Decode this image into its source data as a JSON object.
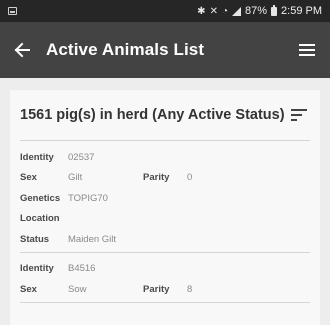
{
  "status_bar": {
    "icons": [
      "image-notification-icon",
      "bluetooth-icon",
      "mute-icon",
      "wifi-icon",
      "cell-signal-icon",
      "battery-icon"
    ],
    "battery": "87%",
    "time": "2:59 PM"
  },
  "app_bar": {
    "title": "Active Animals List",
    "back_icon": "arrow-left-icon",
    "menu_icon": "hamburger-menu-icon",
    "background": "#434343"
  },
  "summary": {
    "text": "1561 pig(s) in herd (Any Active Status)",
    "sort_icon": "sort-icon"
  },
  "labels": {
    "identity": "Identity",
    "sex": "Sex",
    "parity": "Parity",
    "genetics": "Genetics",
    "location": "Location",
    "status": "Status"
  },
  "animals": [
    {
      "identity": "02537",
      "sex": "Gilt",
      "parity": "0",
      "genetics": "TOPIG70",
      "location": "",
      "status": "Maiden Gilt"
    },
    {
      "identity": "B4516",
      "sex": "Sow",
      "parity": "8"
    }
  ]
}
